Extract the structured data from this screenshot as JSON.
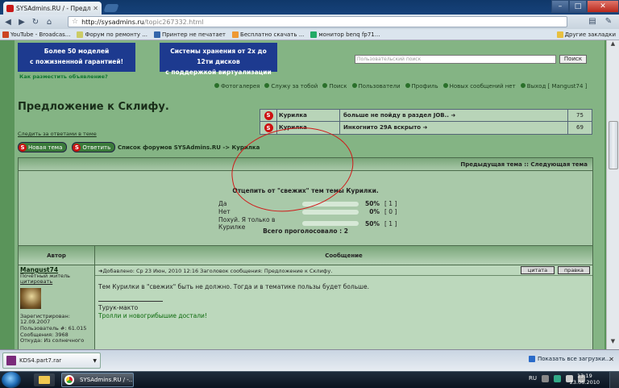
{
  "browser": {
    "tab_title": "SYSAdmins.RU / - Предл...",
    "url_host": "http://sysadmins.ru",
    "url_path": "/topic267332.html",
    "bookmarks": [
      {
        "label": "YouTube - Broadcas..."
      },
      {
        "label": "Форум по ремонту ..."
      },
      {
        "label": "Принтер не печатает"
      },
      {
        "label": "Бесплатно скачать ..."
      },
      {
        "label": "монитор benq fp71..."
      }
    ],
    "other_bookmarks": "Другие закладки"
  },
  "page": {
    "banner_left": [
      "Более 50 моделей",
      "с пожизненной гарантией!"
    ],
    "banner_right": [
      "Системы хранения от 2х до 12ти дисков",
      "с поддержкой виртуализации"
    ],
    "how_to_ad": "Как разместить объявление?",
    "search_placeholder": "Пользовательский поиск",
    "search_button": "Поиск",
    "top_links": [
      "Фотогалерея",
      "Служу за тобой",
      "Поиск",
      "Пользователи",
      "Профиль",
      "Новых сообщений нет",
      "Выход [ Mangust74 ]"
    ],
    "title": "Предложение к Склифу.",
    "watch_link": "Следить за ответами в теме",
    "new_topic": "Новая тема",
    "reply": "Ответить",
    "breadcrumbs": "Список форумов SYSAdmins.RU -> Курилка",
    "topics_table": [
      {
        "forum": "Курилка",
        "topic": "больше не пойду в раздел JOB..",
        "count": "75"
      },
      {
        "forum": "Курилка",
        "topic": "Инкогнито 29А вскрыто",
        "count": "69"
      }
    ],
    "thread_nav": "Предыдущая тема :: Следующая тема"
  },
  "poll": {
    "question": "Отцепить от \"свежих\" тем темы Курилки.",
    "options": [
      {
        "label": "Да",
        "pct": 50,
        "pct_text": "50%",
        "votes": "[ 1 ]"
      },
      {
        "label": "Нет",
        "pct": 0,
        "pct_text": "0%",
        "votes": "[ 0 ]"
      },
      {
        "label": "Похуй. Я только в Курилке",
        "pct": 50,
        "pct_text": "50%",
        "votes": "[ 1 ]"
      }
    ],
    "total": "Всего проголосовало : 2"
  },
  "post": {
    "col_author": "Автор",
    "col_message": "Сообщение",
    "author": "Mangust74",
    "author_info": [
      "Почётный житель",
      "цитировать"
    ],
    "stats": [
      "Зарегистрирован:",
      "12.09.2007",
      "Пользователь #: 61.015",
      "Сообщения: 3968",
      "Откуда: Из солнечного"
    ],
    "header": "Добавлено: Ср 23 Июн, 2010 12:16    Заголовок сообщения: Предложение к Склифу.",
    "quote_btn": "цитата",
    "edit_btn": "правка",
    "body": "Тем Курилки в \"свежих\" быть не должно. Тогда и в тематике пользы будет больше.",
    "sig_line1": "Турук-макто",
    "sig_line2": "Тролли и новогрибышие достали!"
  },
  "downloads": {
    "file": "KDS4.part7.rar",
    "show_all": "Показать все загрузки..."
  },
  "taskbar": {
    "task_label": "SYSAdmins.RU / -...",
    "lang": "RU",
    "time": "13:19",
    "date": "23.06.2010"
  },
  "colors": {
    "page_bg": "#84b484",
    "forum_green": "#5a945a",
    "annotation_red": "#d01818"
  }
}
